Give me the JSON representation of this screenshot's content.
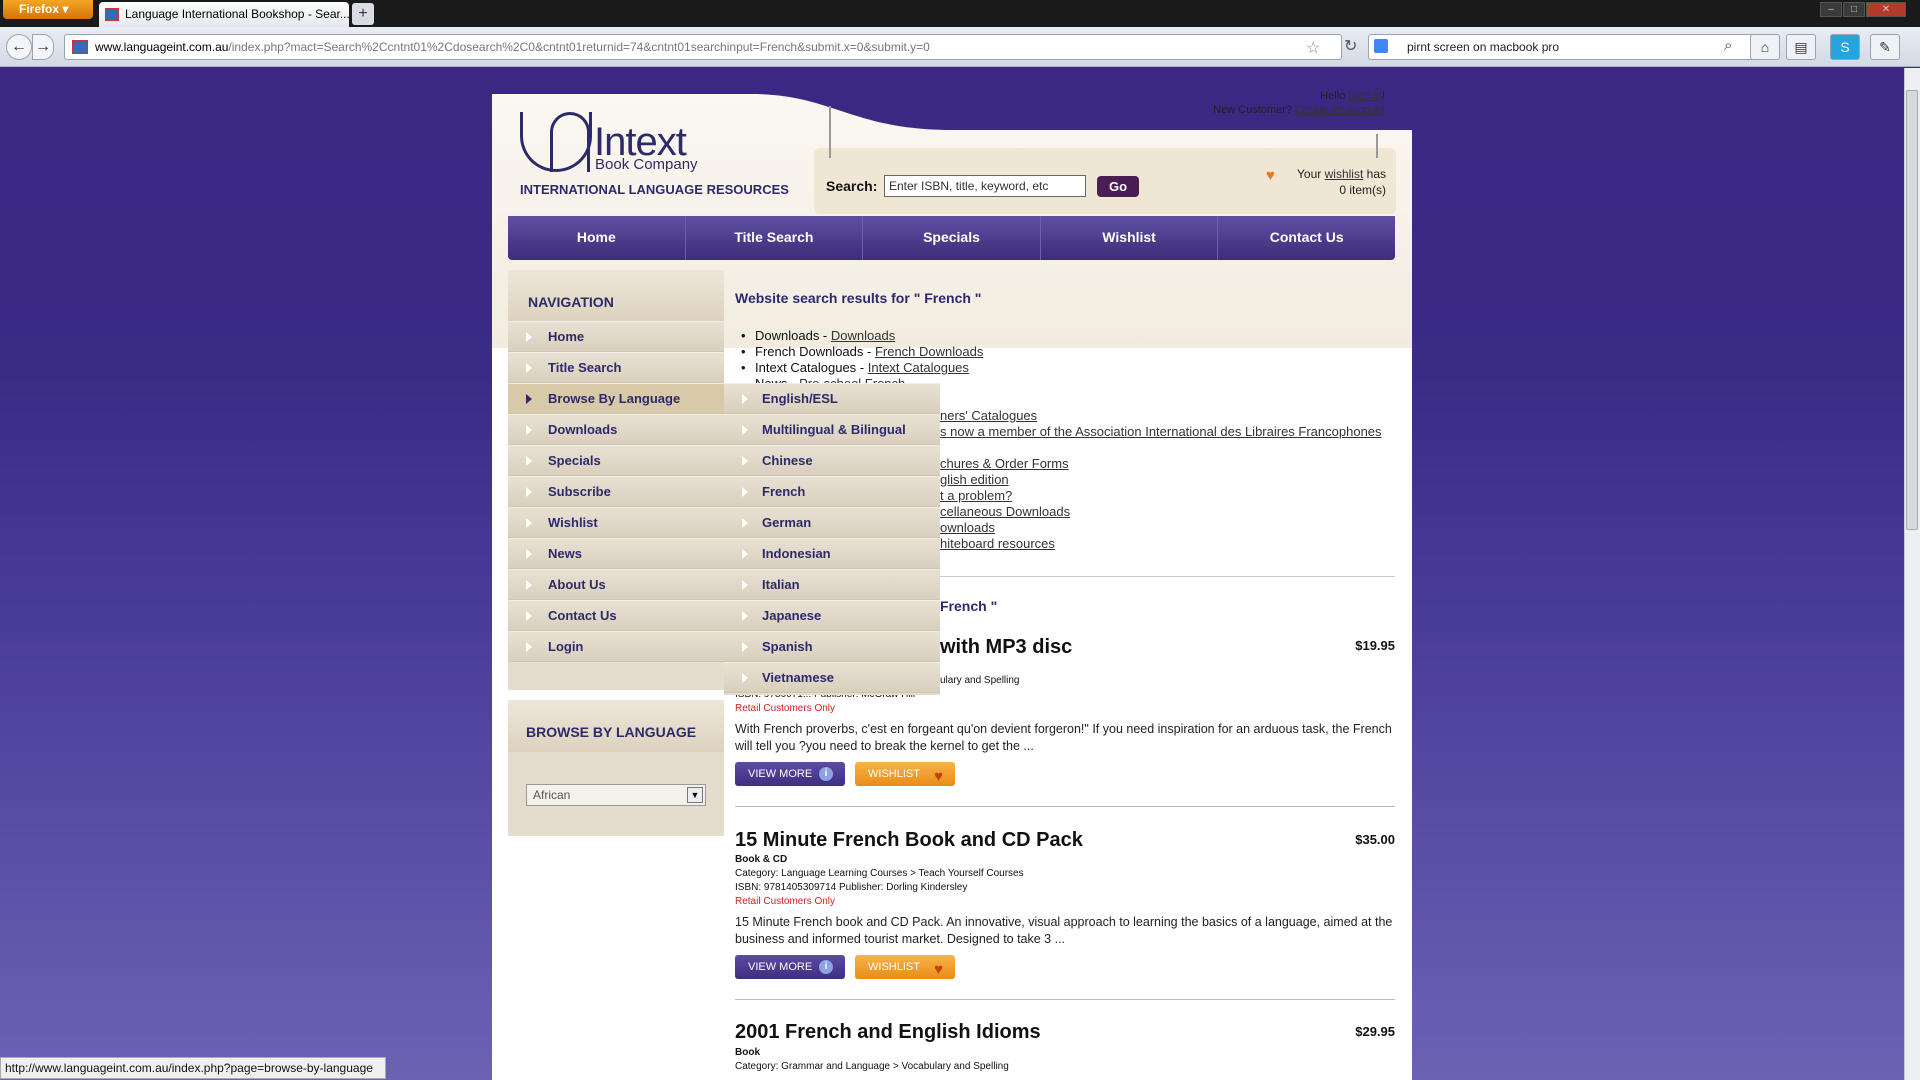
{
  "browser": {
    "app_button": "Firefox",
    "tab_title": "Language International Bookshop - Sear...",
    "new_tab": "+",
    "url_domain": "www.languageint.com.au",
    "url_path": "/index.php?mact=Search%2Ccntnt01%2Cdosearch%2C0&cntnt01returnid=74&cntnt01searchinput=French&submit.x=0&submit.y=0",
    "search_value": "pirnt screen on macbook pro",
    "status_url": "http://www.languageint.com.au/index.php?page=browse-by-language"
  },
  "header": {
    "hello": "Hello",
    "sign_in": "Sign in",
    "excl": "!",
    "new_customer": "New Customer?",
    "create_account": "Create an account",
    "logo_brand": "Intext",
    "logo_sub": "Book Company",
    "logo_tagline": "INTERNATIONAL LANGUAGE RESOURCES",
    "search_label": "Search:",
    "search_placeholder": "Enter ISBN, title, keyword, etc",
    "go_label": "Go",
    "wish_your": "Your",
    "wish_link": "wishlist",
    "wish_has": "has",
    "wish_count": "0 item(s)"
  },
  "main_menu": [
    "Home",
    "Title Search",
    "Specials",
    "Wishlist",
    "Contact Us"
  ],
  "sidebar": {
    "nav_title": "NAVIGATION",
    "items": [
      "Home",
      "Title Search",
      "Browse By Language",
      "Downloads",
      "Specials",
      "Subscribe",
      "Wishlist",
      "News",
      "About Us",
      "Contact Us",
      "Login"
    ],
    "browse_title": "BROWSE BY LANGUAGE",
    "browse_selected": "African"
  },
  "flyout": [
    "English/ESL",
    "Multilingual & Bilingual",
    "Chinese",
    "French",
    "German",
    "Indonesian",
    "Italian",
    "Japanese",
    "Spanish",
    "Vietnamese"
  ],
  "results": {
    "heading": "Website search results for \" French \"",
    "lines": [
      {
        "prefix": "Downloads - ",
        "link": "Downloads"
      },
      {
        "prefix": "French Downloads - ",
        "link": "French Downloads"
      },
      {
        "prefix": "Intext Catalogues - ",
        "link": "Intext Catalogues"
      },
      {
        "prefix": "News - ",
        "link": "Pre-school French"
      }
    ],
    "fragments": [
      "ners' Catalogues",
      "s now a member of the Association International des Libraires Francophones",
      "chures & Order Forms",
      "glish edition",
      "t a problem?",
      "cellaneous Downloads",
      "ownloads",
      "hiteboard resources"
    ],
    "second_heading_fragment": "French \""
  },
  "products": [
    {
      "title_fragment": "with MP3 disc",
      "price": "$19.95",
      "category_fragment": "ulary and Spelling",
      "isbn_fragment": "ISBN: 9780071... Publisher: McGraw Hill",
      "retail": "Retail Customers Only",
      "desc": "With French proverbs, c'est en forgeant qu'on devient forgeron!\" If you need inspiration for an arduous task, the French will tell you ?you need to break the kernel to get the ...",
      "view_more": "VIEW MORE",
      "wishlist": "WISHLIST"
    },
    {
      "title": "15 Minute French Book and CD Pack",
      "price": "$35.00",
      "format": "Book & CD",
      "category": "Category: Language Learning Courses > Teach Yourself Courses",
      "isbn": "ISBN: 9781405309714 Publisher: Dorling Kindersley",
      "retail": "Retail Customers Only",
      "desc": "15 Minute French book and CD Pack. An innovative, visual approach to learning the basics of a language, aimed at the business and informed tourist market. Designed to take 3 ...",
      "view_more": "VIEW MORE",
      "wishlist": "WISHLIST"
    },
    {
      "title": "2001 French and English Idioms",
      "price": "$29.95",
      "format": "Book",
      "category": "Category: Grammar and Language > Vocabulary and Spelling"
    }
  ]
}
